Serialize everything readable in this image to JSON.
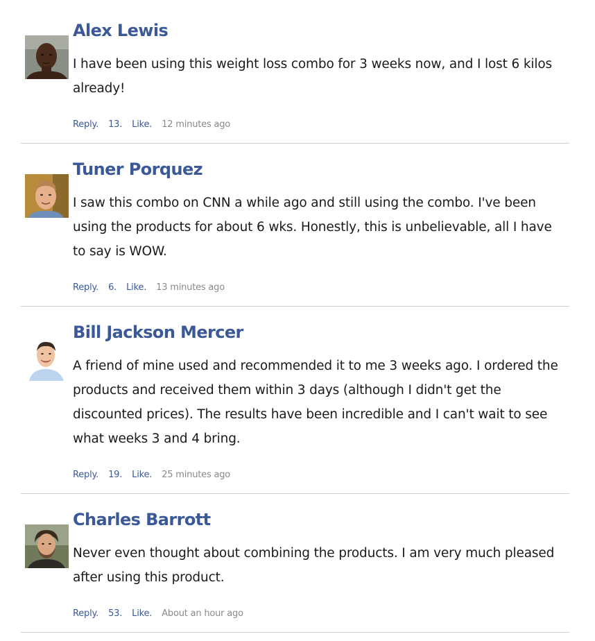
{
  "comments": [
    {
      "name": "Alex Lewis",
      "text": "I have been using this weight loss combo for 3 weeks now, and I lost 6 kilos already!",
      "reply": "Reply.",
      "likes": "13.",
      "like": "Like.",
      "time": "12 minutes ago",
      "avatar_icon": "avatar-photo-icon"
    },
    {
      "name": "Tuner Porquez",
      "text": "I saw this combo on CNN a while ago and still using the combo. I've been using the products for about 6 wks. Honestly, this is unbelievable, all I have to say is WOW.",
      "reply": "Reply.",
      "likes": "6.",
      "like": "Like.",
      "time": "13 minutes ago",
      "avatar_icon": "avatar-photo-icon"
    },
    {
      "name": "Bill Jackson Mercer",
      "text": "A friend of mine used and recommended it to me 3 weeks ago. I ordered the products and received them within 3 days (although I didn't get the discounted prices). The results have been incredible and I can't wait to see what weeks 3 and 4 bring.",
      "reply": "Reply.",
      "likes": "19.",
      "like": "Like.",
      "time": "25 minutes ago",
      "avatar_icon": "avatar-photo-icon"
    },
    {
      "name": "Charles Barrott",
      "text": "Never even thought about combining the products. I am very much pleased after using this product.",
      "reply": "Reply.",
      "likes": "53.",
      "like": "Like.",
      "time": "About an hour ago",
      "avatar_icon": "avatar-photo-icon"
    }
  ],
  "colors": {
    "link": "#3b5998",
    "text": "#1a1a1a",
    "timestamp": "#8a8a8a",
    "divider": "#cfcfcf"
  }
}
